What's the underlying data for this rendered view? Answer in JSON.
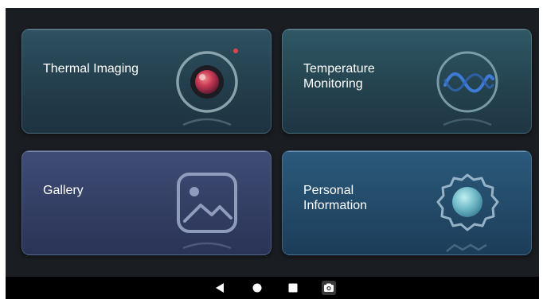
{
  "tiles": {
    "thermal": {
      "label": "Thermal Imaging",
      "icon": "camera-lens-icon"
    },
    "temperature": {
      "label": "Temperature\nMonitoring",
      "icon": "wave-icon"
    },
    "gallery": {
      "label": "Gallery",
      "icon": "image-icon"
    },
    "personal": {
      "label": "Personal\nInformation",
      "icon": "gear-badge-icon"
    }
  },
  "navbar": {
    "back_icon": "back-triangle-icon",
    "home_icon": "home-circle-icon",
    "recents_icon": "recents-square-icon",
    "screenshot_icon": "camera-icon"
  },
  "colors": {
    "screen_bg": "#1a1d22",
    "thermal_tile": "#2e5160",
    "temperature_tile": "#2f5865",
    "gallery_tile": "#3f4d76",
    "personal_tile": "#2b5a7c",
    "lens_accent": "#d2455a",
    "wave_accent": "#3d7bd6",
    "recording_dot": "#e0464b"
  }
}
